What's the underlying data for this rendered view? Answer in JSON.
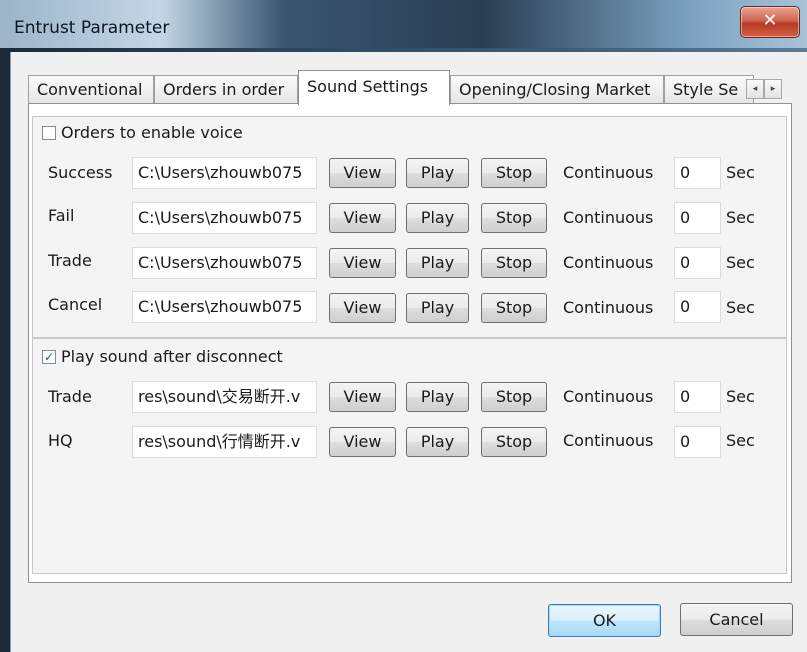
{
  "window": {
    "title": "Entrust Parameter",
    "close_glyph": "✕"
  },
  "tabs": [
    {
      "label": "Conventional"
    },
    {
      "label": "Orders in order"
    },
    {
      "label": "Sound Settings"
    },
    {
      "label": "Opening/Closing Market"
    },
    {
      "label": "Style Se"
    }
  ],
  "tab_scroll": {
    "left": "◂",
    "right": "▸"
  },
  "orders_group": {
    "checkbox_label": "Orders to enable voice",
    "checked": false,
    "rows": [
      {
        "name": "Success",
        "path": "C:\\Users\\zhouwb075",
        "view": "View",
        "play": "Play",
        "stop": "Stop",
        "continuous": "Continuous",
        "seconds": "0",
        "unit": "Sec"
      },
      {
        "name": "Fail",
        "path": "C:\\Users\\zhouwb075",
        "view": "View",
        "play": "Play",
        "stop": "Stop",
        "continuous": "Continuous",
        "seconds": "0",
        "unit": "Sec"
      },
      {
        "name": "Trade",
        "path": "C:\\Users\\zhouwb075",
        "view": "View",
        "play": "Play",
        "stop": "Stop",
        "continuous": "Continuous",
        "seconds": "0",
        "unit": "Sec"
      },
      {
        "name": "Cancel",
        "path": "C:\\Users\\zhouwb075",
        "view": "View",
        "play": "Play",
        "stop": "Stop",
        "continuous": "Continuous",
        "seconds": "0",
        "unit": "Sec"
      }
    ]
  },
  "disconnect_group": {
    "checkbox_label": "Play sound after disconnect",
    "checked": true,
    "check_glyph": "✓",
    "rows": [
      {
        "name": "Trade",
        "path": "res\\sound\\交易断开.v",
        "view": "View",
        "play": "Play",
        "stop": "Stop",
        "continuous": "Continuous",
        "seconds": "0",
        "unit": "Sec"
      },
      {
        "name": "HQ",
        "path": "res\\sound\\行情断开.v",
        "view": "View",
        "play": "Play",
        "stop": "Stop",
        "continuous": "Continuous",
        "seconds": "0",
        "unit": "Sec"
      }
    ]
  },
  "footer": {
    "ok_label": "OK",
    "cancel_label": "Cancel"
  }
}
